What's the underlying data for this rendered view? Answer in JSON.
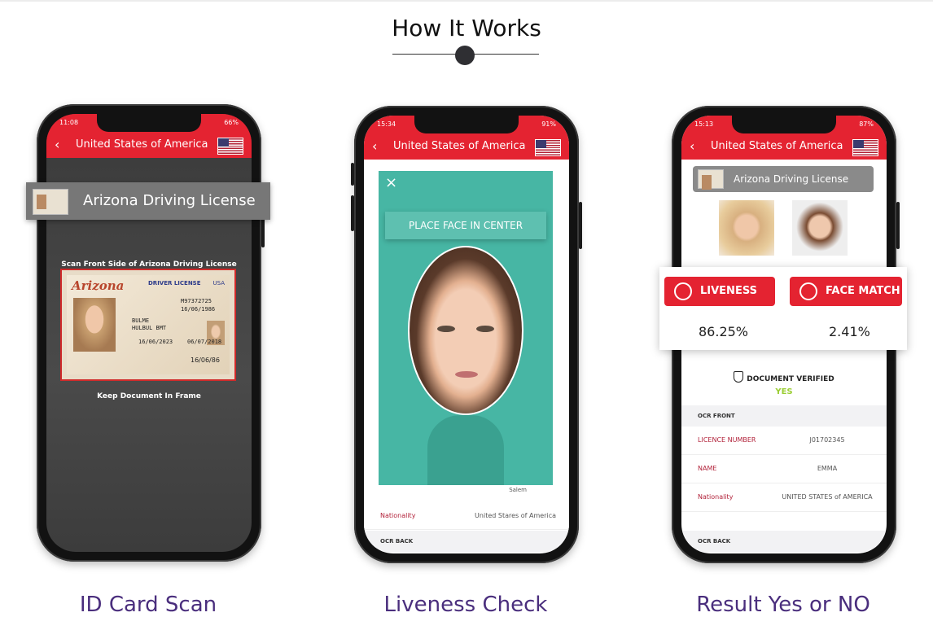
{
  "section": {
    "heading": "How It Works"
  },
  "steps": [
    {
      "caption": "ID Card Scan",
      "status": {
        "time": "11:08",
        "battery": "66%"
      },
      "appbar": {
        "back": "‹",
        "title": "United States of America"
      },
      "document_label": "Arizona Driving License",
      "scan_instruction": "Scan Front Side of Arizona Driving License",
      "frame_hint": "Keep Document In Frame",
      "id_card": {
        "state": "Arizona",
        "type": "DRIVER LICENSE",
        "country": "USA",
        "number": "M97372725",
        "dob": "16/06/1986",
        "name_line1": "BULME",
        "name_line2": "HULBUL BMT",
        "expiry": "16/06/2023",
        "issue": "06/07/2018",
        "date_short": "16/06/86"
      }
    },
    {
      "caption": "Liveness Check",
      "status": {
        "time": "15:34",
        "battery": "91%"
      },
      "appbar": {
        "back": "‹",
        "title": "United States of America"
      },
      "close_icon": "×",
      "face_hint": "PLACE FACE IN CENTER",
      "partial_value": "Salem",
      "rows": [
        {
          "label": "Nationality",
          "value": "United Stares of America"
        }
      ],
      "section_label": "OCR BACK"
    },
    {
      "caption": "Result Yes or NO",
      "status": {
        "time": "15:13",
        "battery": "87%"
      },
      "appbar": {
        "back": "‹",
        "title": "United States of America"
      },
      "document_label": "Arizona Driving License",
      "liveness": {
        "label": "LIVENESS",
        "value": "86.25%"
      },
      "face_match": {
        "label": "FACE MATCH",
        "value": "2.41%"
      },
      "verified_label": "DOCUMENT VERIFIED",
      "verified_value": "YES",
      "ocr_front_label": "OCR FRONT",
      "rows": [
        {
          "label": "LICENCE NUMBER",
          "value": "J01702345"
        },
        {
          "label": "NAME",
          "value": "EMMA"
        },
        {
          "label": "Nationality",
          "value": "UNITED STATES of AMERICA"
        }
      ],
      "ocr_back_label": "OCR BACK"
    }
  ],
  "colors": {
    "accent_red": "#e42331",
    "caption_purple": "#4a2e7d",
    "liveness_teal": "#47b6a4",
    "verified_green": "#9acd32"
  },
  "icons": [
    "back-arrow-icon",
    "us-flag-icon",
    "close-icon",
    "liveness-icon",
    "face-match-icon",
    "shield-check-icon"
  ]
}
